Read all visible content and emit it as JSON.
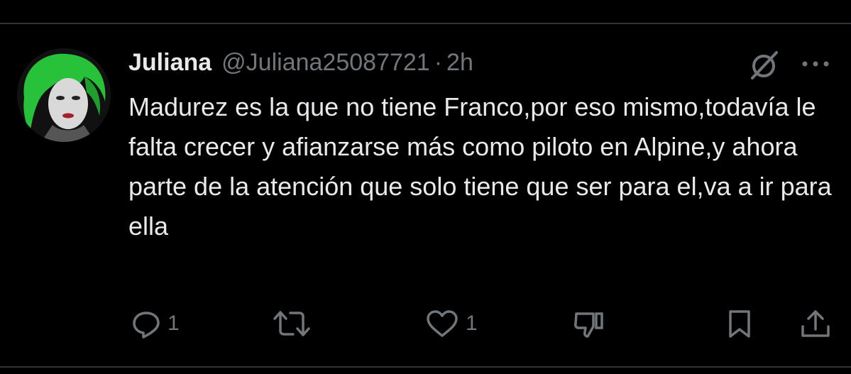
{
  "tweet": {
    "display_name": "Juliana",
    "handle": "@Juliana25087721",
    "separator": "·",
    "time": "2h",
    "text": "Madurez es la que no tiene Franco,por eso mismo,todavía le falta crecer y afianzarse más como piloto en Alpine,y ahora parte de la atención que solo tiene que ser para el,va a ir para ella"
  },
  "actions": {
    "reply_count": "1",
    "retweet_count": "",
    "like_count": "1"
  },
  "icons": {
    "grok": "grok-icon",
    "more": "more-icon",
    "reply": "reply-icon",
    "retweet": "retweet-icon",
    "like": "heart-icon",
    "dislike": "thumbs-down-icon",
    "bookmark": "bookmark-icon",
    "share": "share-icon"
  },
  "colors": {
    "background": "#000000",
    "text_primary": "#e7e9ea",
    "text_secondary": "#71767b",
    "divider": "#2f3336",
    "avatar_hair": "#2ecc40"
  }
}
